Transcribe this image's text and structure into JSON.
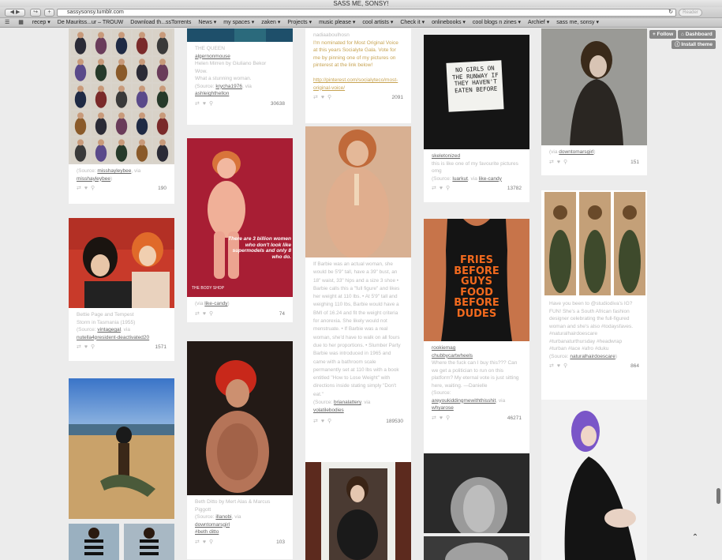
{
  "window": {
    "title": "SASS ME, SONSY!"
  },
  "toolbar": {
    "back_icon": "◀",
    "forward_icon": "▶",
    "share_icon": "↪",
    "new_tab_icon": "+",
    "url": "sassysonsy.tumblr.com",
    "reload_icon": "↻",
    "reader_label": "Reader"
  },
  "bookmarks": {
    "items": [
      "recep ▾",
      "De Mauritss...ur – TROUW",
      "Download th...ssTorrents",
      "News ▾",
      "my spaces ▾",
      "zaken ▾",
      "Projects ▾",
      "music please ▾",
      "cool artists ▾",
      "Check it ▾",
      "onlinebooks ▾",
      "cool blogs n zines ▾",
      "Archief ▾",
      "sass me, sonsy ▾"
    ]
  },
  "tumblr": {
    "follow_label": "+ Follow",
    "dashboard_label": "Dashboard",
    "install_label": "Install theme"
  },
  "posts": {
    "p1": {
      "src_pre": "(Source: ",
      "src1": "misshayleybee",
      "src_mid": ", via ",
      "src2": "misshayleybee",
      "src_post": ")",
      "notes": "190"
    },
    "p2": {
      "line1": "Bettie Page and Tempest",
      "line2": "Storm in Tasmania (1955)",
      "src_pre": "(Source: ",
      "src1": "vintagegal",
      "src_mid": ", via ",
      "src2": "nutella4president-deactivated20",
      "notes": "1571"
    },
    "p4": {
      "line1": "THE QUEEN",
      "link1": "algernonmouse",
      "line2": "Helen Mirren by Giuliano Bekor",
      "line3": "Wow.",
      "line4": "What a stunning woman.",
      "src_pre": "(Source: ",
      "src1": "krycha1976",
      "src_mid": ", via ",
      "src2": "ashleighthellon",
      "notes": "30638"
    },
    "p5": {
      "img_text1": "There are 3 billion women who don't look like supermodels and only 8 who do.",
      "img_text2": "THE BODY SHOP",
      "src_pre": "(via ",
      "src1": "like-candy",
      "src_post": ")",
      "notes": "74"
    },
    "p6": {
      "line1": "Beth Ditto by Mert Alas & Marcus",
      "line2": "Piggott",
      "src_pre": "(Source: ",
      "src1": "illanobi",
      "src_mid": ", via ",
      "src2": "downtomarsgirl",
      "tag": "#beth ditto",
      "notes": "103"
    },
    "p7": {
      "top": "nadiaaboulhosn",
      "line1": "I'm nominated for Most Original Voice at this years Socialyte Gala. Vote for me by pinning one of my pictures on pinterest at the link below!",
      "link": "http://pinterest.com/socialyteco/most-original-voice/",
      "notes": "2091"
    },
    "p8": {
      "text": "If Barbie was an actual woman, she would be 5'9\" tall, have a 39\" bust, an 18\" waist, 33\" hips and a size 3 shoe • Barbie calls this a \"full figure\" and likes her weight at 110 lbs. • At 5'9\" tall and weighing 110 lbs, Barbie would have a BMI of 16.24 and fit the weight criteria for anorexia. She likely would not menstruate. • If Barbie was a real woman, she'd have to walk on all fours due to her proportions. • Slumber Party Barbie was introduced in 1965 and came with a bathroom scale permanently set at 110 lbs with a book entitled \"How to Lose Weight\" with directions inside stating simply \"Don't eat.\"",
      "src_pre": "(Source: ",
      "src1": "brianalattery",
      "src_mid": ", via ",
      "src2": "volatilebodies",
      "notes": "189530"
    },
    "p10": {
      "sign": "NO GIRLS ON THE RUNWAY IF THEY HAVEN'T EATEN BEFORE",
      "link1": "skeletonized",
      "line1": "this is like one of my favourite pictures omg",
      "src_pre": "(Source: ",
      "src1": "luarkut",
      "src_mid": ", via ",
      "src2": "like-candy",
      "notes": "13782"
    },
    "p11": {
      "shirt": "FRIES BEFORE GUYS FOOD BEFORE DUDES",
      "link1": "rookiemag",
      "link2": "chubbycartwheels",
      "line1": "Where the fuck can I buy this??? Can we get a politician to run on this platform? My eternal vote is just sitting here, waiting. —Danielle",
      "src_pre": "(Source: ",
      "src1": "areyoukiddingmewiththisshit",
      "src_mid": ", via ",
      "src2": "whyarose",
      "notes": "46271"
    },
    "p13": {
      "src_pre": "(via ",
      "src1": "downtomarsgirl",
      "src_post": ")",
      "notes": "151"
    },
    "p14": {
      "text": "Have you been to @studiodiva's IG? FUN! She's a South African fashion designer celebrating the full-figured woman and she's also #todaysfaves. #naturalhairdoescare #turbanaturthursday #headwrap #turban #lace #afro #duku",
      "src_pre": "(Source: ",
      "src1": "naturalhairdoescare",
      "src_post": ")",
      "notes": "864"
    }
  },
  "icons": {
    "reblog": "reblog-icon",
    "like": "heart-icon",
    "search": "magnify-icon"
  },
  "scroll_top_icon": "⌃"
}
